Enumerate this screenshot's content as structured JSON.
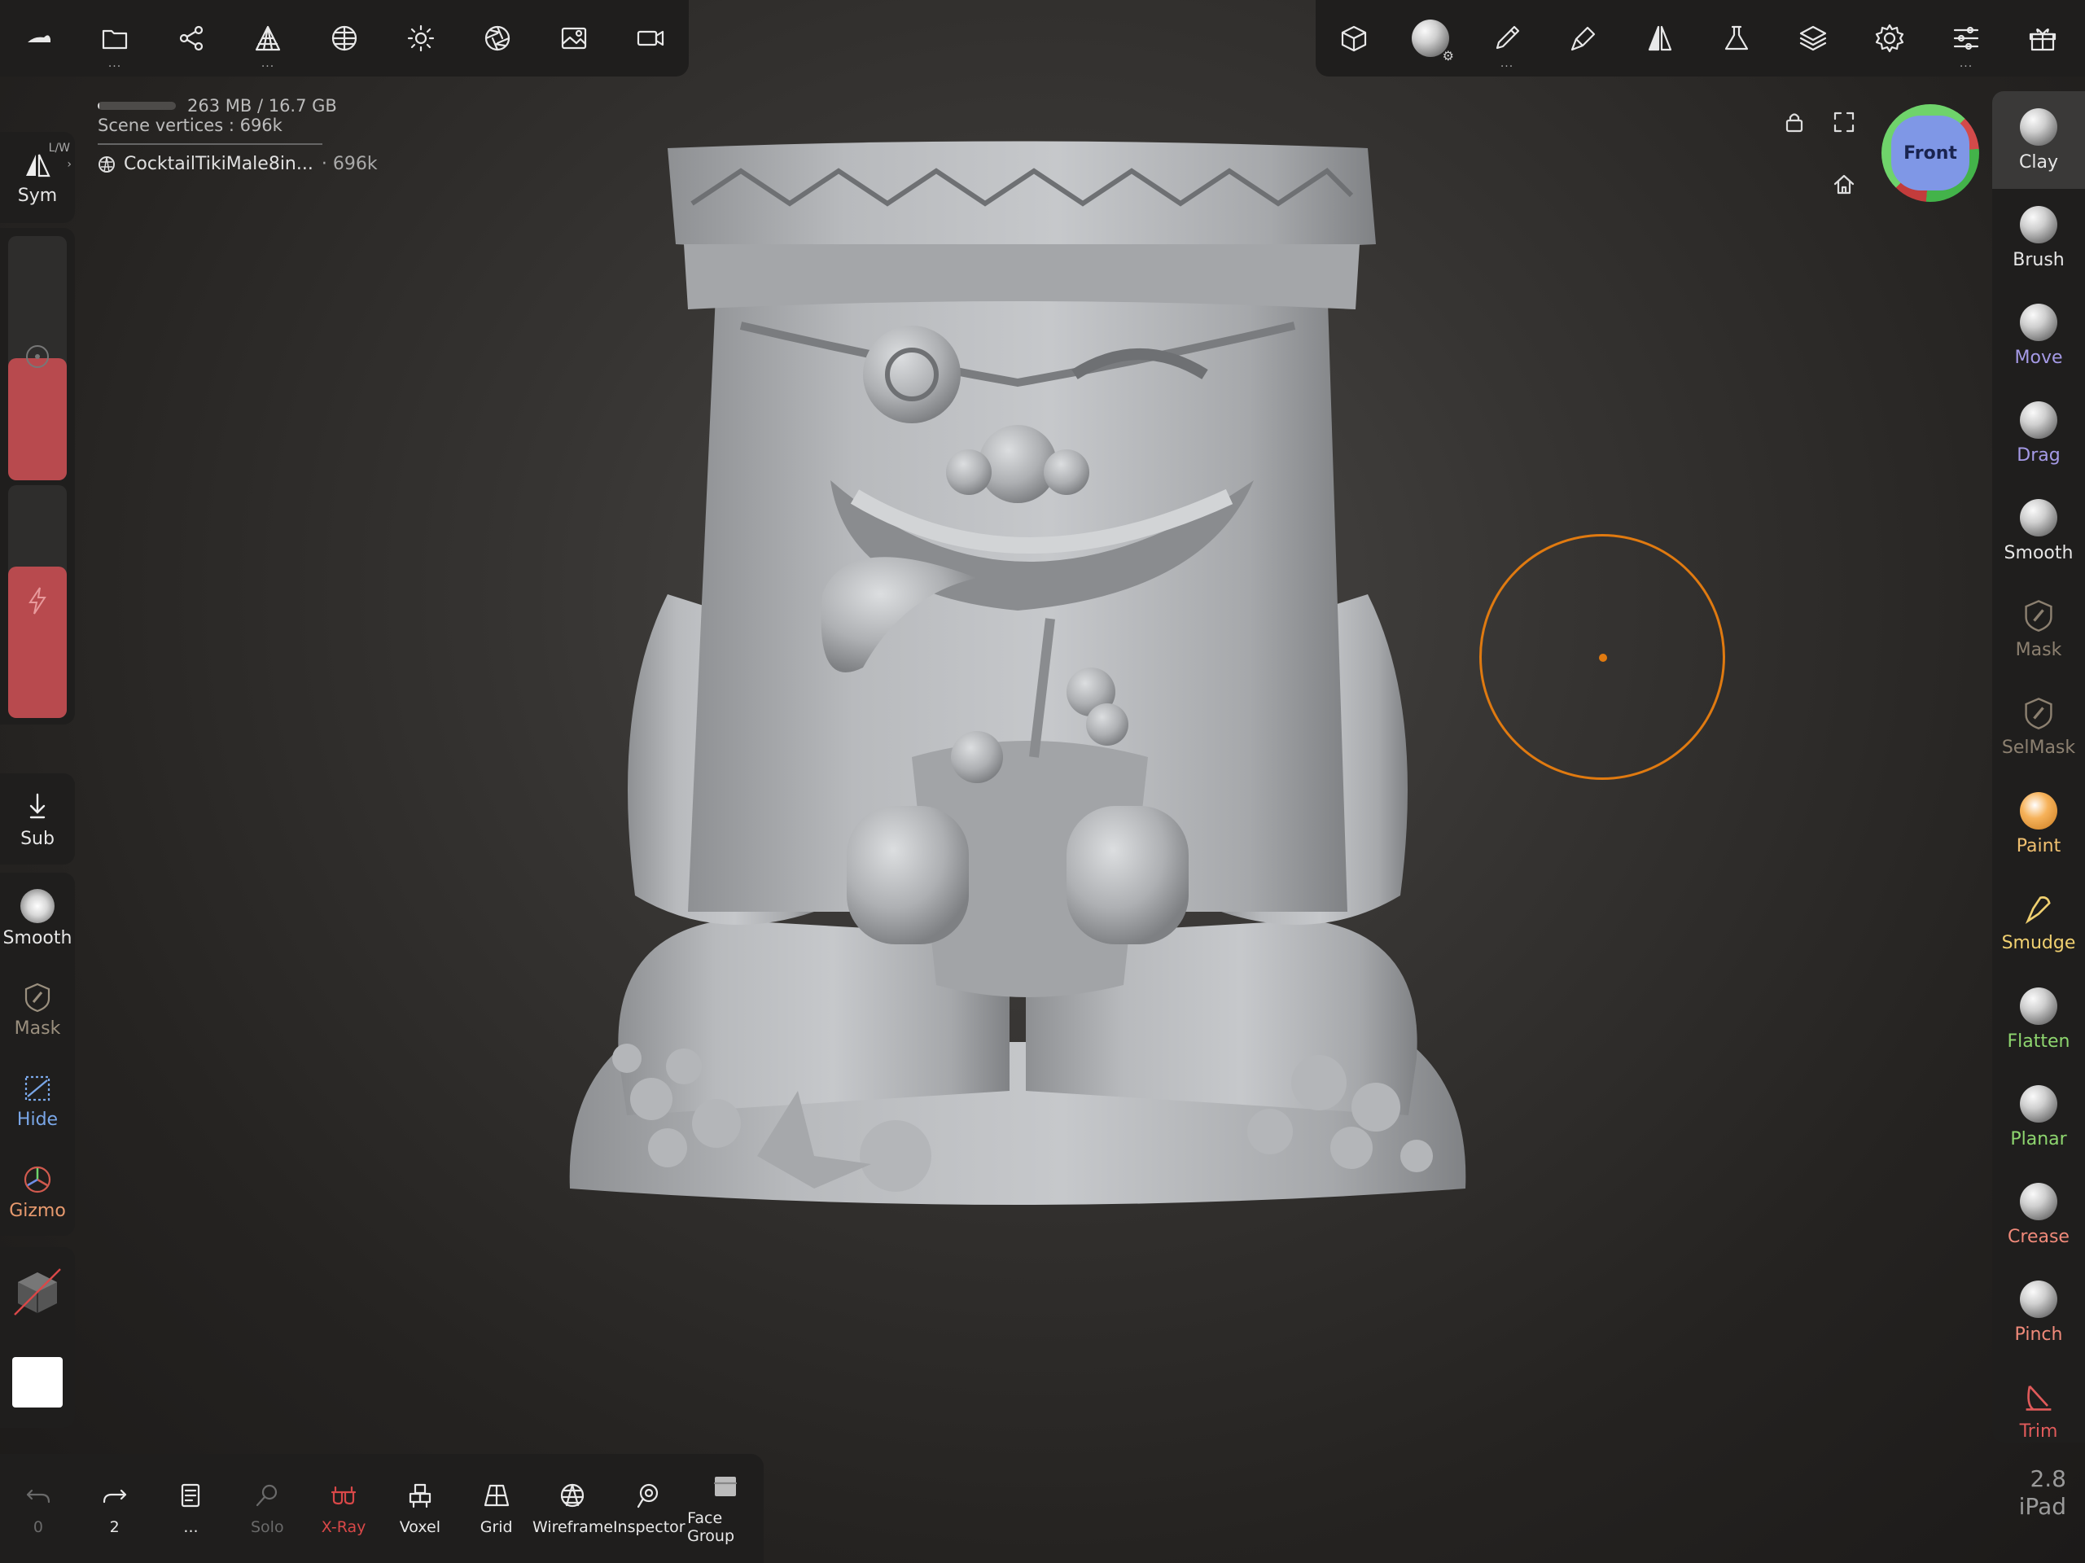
{
  "top_toolbar_left": [
    {
      "name": "logo-icon",
      "dots": ""
    },
    {
      "name": "folder-icon",
      "dots": "..."
    },
    {
      "name": "scene-tree-icon",
      "dots": ""
    },
    {
      "name": "topology-icon",
      "dots": "..."
    },
    {
      "name": "material-icon",
      "dots": ""
    },
    {
      "name": "light-icon",
      "dots": ""
    },
    {
      "name": "camera-aperture-icon",
      "dots": ""
    },
    {
      "name": "image-icon",
      "dots": ""
    },
    {
      "name": "video-camera-icon",
      "dots": ""
    }
  ],
  "top_toolbar_right": [
    {
      "name": "scene-cube-icon",
      "dots": ""
    },
    {
      "name": "matcap-sphere-icon",
      "dots": ""
    },
    {
      "name": "brush-pen-icon",
      "dots": "..."
    },
    {
      "name": "stroke-tool-icon",
      "dots": ""
    },
    {
      "name": "symmetry-icon",
      "dots": ""
    },
    {
      "name": "flask-icon",
      "dots": ""
    },
    {
      "name": "layers-icon",
      "dots": ""
    },
    {
      "name": "settings-gear-icon",
      "dots": ""
    },
    {
      "name": "sliders-icon",
      "dots": "..."
    },
    {
      "name": "gift-icon",
      "dots": ""
    }
  ],
  "info": {
    "memory": "263 MB / 16.7 GB",
    "memory_used_fraction": 0.016,
    "scene_vertices": "Scene vertices : 696k",
    "mesh_name": "CocktailTikiMale8in...",
    "mesh_vertices": "· 696k"
  },
  "left_toolbar": {
    "sym_label": "Sym",
    "sym_corner": "L/W",
    "sub_label": "Sub",
    "smooth_label": "Smooth",
    "mask_label": "Mask",
    "hide_label": "Hide",
    "gizmo_label": "Gizmo",
    "radius_fraction": 0.5,
    "intensity_fraction": 0.65
  },
  "viewcube": {
    "face": "Front"
  },
  "right_tools": [
    {
      "label": "Clay",
      "color": "#e6e6e6",
      "active": true
    },
    {
      "label": "Brush",
      "color": "#e6e6e6"
    },
    {
      "label": "Move",
      "color": "#a59ae6"
    },
    {
      "label": "Drag",
      "color": "#a59ae6"
    },
    {
      "label": "Smooth",
      "color": "#e6e6e6"
    },
    {
      "label": "Mask",
      "color": "#8c8070"
    },
    {
      "label": "SelMask",
      "color": "#8c8070"
    },
    {
      "label": "Paint",
      "color": "#f0c070"
    },
    {
      "label": "Smudge",
      "color": "#f0d070"
    },
    {
      "label": "Flatten",
      "color": "#8ed66f"
    },
    {
      "label": "Planar",
      "color": "#8ed66f"
    },
    {
      "label": "Crease",
      "color": "#f08a7a"
    },
    {
      "label": "Pinch",
      "color": "#f08a7a"
    },
    {
      "label": "Trim",
      "color": "#e05a5a"
    }
  ],
  "bottom_toolbar": [
    {
      "label": "0",
      "name": "undo-button",
      "icon": "undo-icon",
      "color": "#6a6a6a"
    },
    {
      "label": "2",
      "name": "redo-button",
      "icon": "redo-icon",
      "color": "#e8e8e8"
    },
    {
      "label": "...",
      "name": "history-button",
      "icon": "document-icon",
      "color": "#e8e8e8"
    },
    {
      "label": "Solo",
      "name": "solo-button",
      "icon": "magnifier-icon",
      "color": "#6a6a6a"
    },
    {
      "label": "X-Ray",
      "name": "xray-button",
      "icon": "xray-glasses-icon",
      "color": "#d94848"
    },
    {
      "label": "Voxel",
      "name": "voxel-button",
      "icon": "voxel-icon",
      "color": "#e8e8e8"
    },
    {
      "label": "Grid",
      "name": "grid-button",
      "icon": "grid-plane-icon",
      "color": "#e8e8e8"
    },
    {
      "label": "Wireframe",
      "name": "wireframe-button",
      "icon": "wireframe-icon",
      "color": "#e8e8e8"
    },
    {
      "label": "Inspector",
      "name": "inspector-button",
      "icon": "inspector-icon",
      "color": "#e8e8e8"
    },
    {
      "label": "Face Group",
      "name": "face-group-button",
      "icon": "face-group-icon",
      "color": "#e8e8e8"
    }
  ],
  "version": {
    "number": "2.8",
    "device": "iPad"
  }
}
